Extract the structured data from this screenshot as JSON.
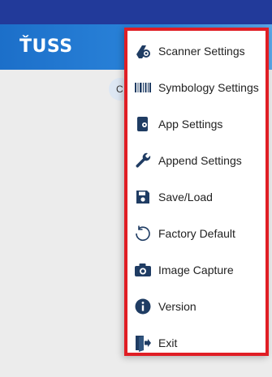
{
  "app": {
    "logo_text": "ŤUSS"
  },
  "content": {
    "partial_chip_text": "C"
  },
  "menu": {
    "items": [
      {
        "label": "Scanner Settings",
        "icon": "scanner-gear-icon"
      },
      {
        "label": "Symbology Settings",
        "icon": "barcode-icon"
      },
      {
        "label": "App Settings",
        "icon": "app-settings-icon"
      },
      {
        "label": "Append Settings",
        "icon": "wrench-icon"
      },
      {
        "label": "Save/Load",
        "icon": "floppy-disk-icon"
      },
      {
        "label": "Factory Default",
        "icon": "reset-icon"
      },
      {
        "label": "Image Capture",
        "icon": "camera-icon"
      },
      {
        "label": "Version",
        "icon": "info-icon"
      },
      {
        "label": "Exit",
        "icon": "exit-icon"
      }
    ]
  },
  "colors": {
    "status_bar": "#223a9a",
    "app_bar": "#2c86dc",
    "highlight_border": "#e01e25",
    "icon": "#1f3c63"
  }
}
